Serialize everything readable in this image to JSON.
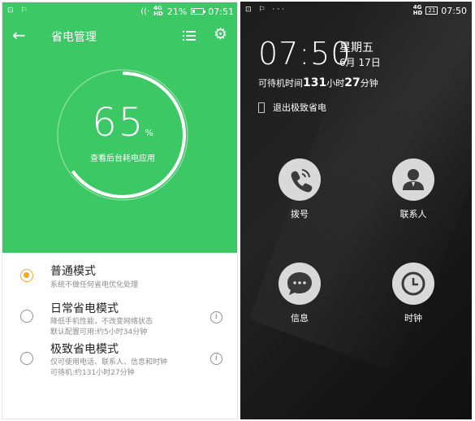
{
  "left": {
    "status": {
      "left_icons": "⊡ ⚐",
      "wifi": "((·",
      "signal_text": "4G\nHD",
      "battery_text": "21%",
      "battery_level": 0.21,
      "time": "07:51"
    },
    "header": {
      "title": "省电管理",
      "back_icon": "back-arrow-icon",
      "menu_icon": "list-menu-icon",
      "settings_icon": "gear-icon"
    },
    "ring": {
      "value": "65",
      "unit": "%",
      "progress": 0.65,
      "subtitle": "查看后台耗电应用"
    },
    "modes": [
      {
        "name": "普通模式",
        "desc_lines": [
          "系统不做任何省电优化处理"
        ],
        "selected": true,
        "info": false
      },
      {
        "name": "日常省电模式",
        "desc_lines": [
          "降低手机性能，不改变网络状态",
          "默认配置可用:约5小时34分钟"
        ],
        "selected": false,
        "info": true
      },
      {
        "name": "极致省电模式",
        "desc_lines": [
          "仅可使用电话、联系人、信息和时钟",
          "可待机:约131小时27分钟"
        ],
        "selected": false,
        "info": true
      }
    ],
    "colors": {
      "accent": "#3cc864",
      "radio_selected": "#f5a623"
    }
  },
  "right": {
    "status": {
      "left_icons": "⊡ ⚐ ···",
      "signal_text": "4G\nHD",
      "battery_text": "21",
      "time": "07:50"
    },
    "clock": "07:50",
    "weekday": "星期五",
    "date": "6月 17日",
    "standby": {
      "prefix": "可待机时间",
      "hours": "131",
      "hours_unit": "小时",
      "minutes": "27",
      "minutes_unit": "分钟"
    },
    "exit_label": "退出极致省电",
    "apps": [
      {
        "label": "拨号",
        "icon": "phone-icon"
      },
      {
        "label": "联系人",
        "icon": "contact-icon"
      },
      {
        "label": "信息",
        "icon": "message-icon"
      },
      {
        "label": "时钟",
        "icon": "clock-icon"
      }
    ]
  }
}
